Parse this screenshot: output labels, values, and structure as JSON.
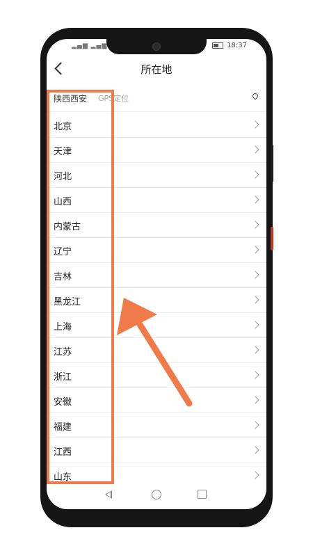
{
  "status": {
    "signal": "▂▄▆ ▂▄▆ ◌",
    "time": "18:37"
  },
  "header": {
    "title": "所在地"
  },
  "location": {
    "current_city": "陕西西安",
    "tag": "GPS定位"
  },
  "provinces": [
    "北京",
    "天津",
    "河北",
    "山西",
    "内蒙古",
    "辽宁",
    "吉林",
    "黑龙江",
    "上海",
    "江苏",
    "浙江",
    "安徽",
    "福建",
    "江西",
    "山东"
  ],
  "colors": {
    "highlight": "#f07a4a"
  },
  "icons": {
    "back": "chevron-left-icon",
    "pin": "location-pin-icon",
    "row": "chevron-right-icon"
  }
}
